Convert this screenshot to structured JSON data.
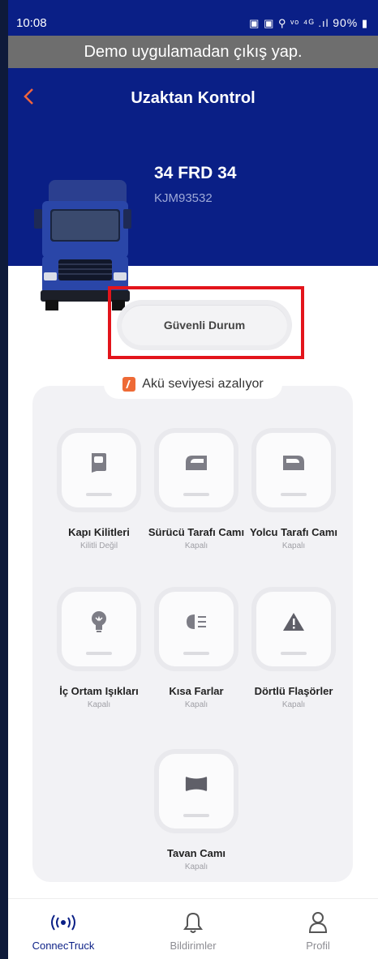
{
  "status_bar": {
    "time": "10:08",
    "icons": "▣ ▣ ⚲ ᵛᵒ ⁴ᴳ .ıl",
    "battery": "90%"
  },
  "demo_bar": {
    "text": "Demo uygulamadan çıkış yap."
  },
  "header": {
    "title": "Uzaktan Kontrol",
    "back_icon": "chevron-left-icon"
  },
  "vehicle": {
    "plate": "34 FRD 34",
    "vin": "KJM93532"
  },
  "safe_mode": {
    "label": "Güvenli Durum"
  },
  "battery_warning": {
    "text": "Akü seviyesi azalıyor",
    "color": "#ee6a36"
  },
  "controls": [
    {
      "name": "Kapı Kilitleri",
      "state": "Kilitli Değil",
      "icon": "door-icon"
    },
    {
      "name": "Sürücü Tarafı Camı",
      "state": "Kapalı",
      "icon": "driver-window-icon"
    },
    {
      "name": "Yolcu Tarafı Camı",
      "state": "Kapalı",
      "icon": "passenger-window-icon"
    },
    {
      "name": "İç Ortam Işıkları",
      "state": "Kapalı",
      "icon": "interior-light-icon"
    },
    {
      "name": "Kısa Farlar",
      "state": "Kapalı",
      "icon": "headlight-icon"
    },
    {
      "name": "Dörtlü Flaşörler",
      "state": "Kapalı",
      "icon": "hazard-icon"
    },
    {
      "name": "Tavan Camı",
      "state": "Kapalı",
      "icon": "sunroof-icon"
    }
  ],
  "bottom_nav": [
    {
      "label": "ConnecTruck",
      "icon": "connectruck-icon",
      "active": true
    },
    {
      "label": "Bildirimler",
      "icon": "bell-icon",
      "active": false
    },
    {
      "label": "Profil",
      "icon": "profile-icon",
      "active": false
    }
  ],
  "colors": {
    "brand_blue": "#0a1f86",
    "accent_orange": "#f0643c",
    "highlight_red": "#e3141b"
  }
}
